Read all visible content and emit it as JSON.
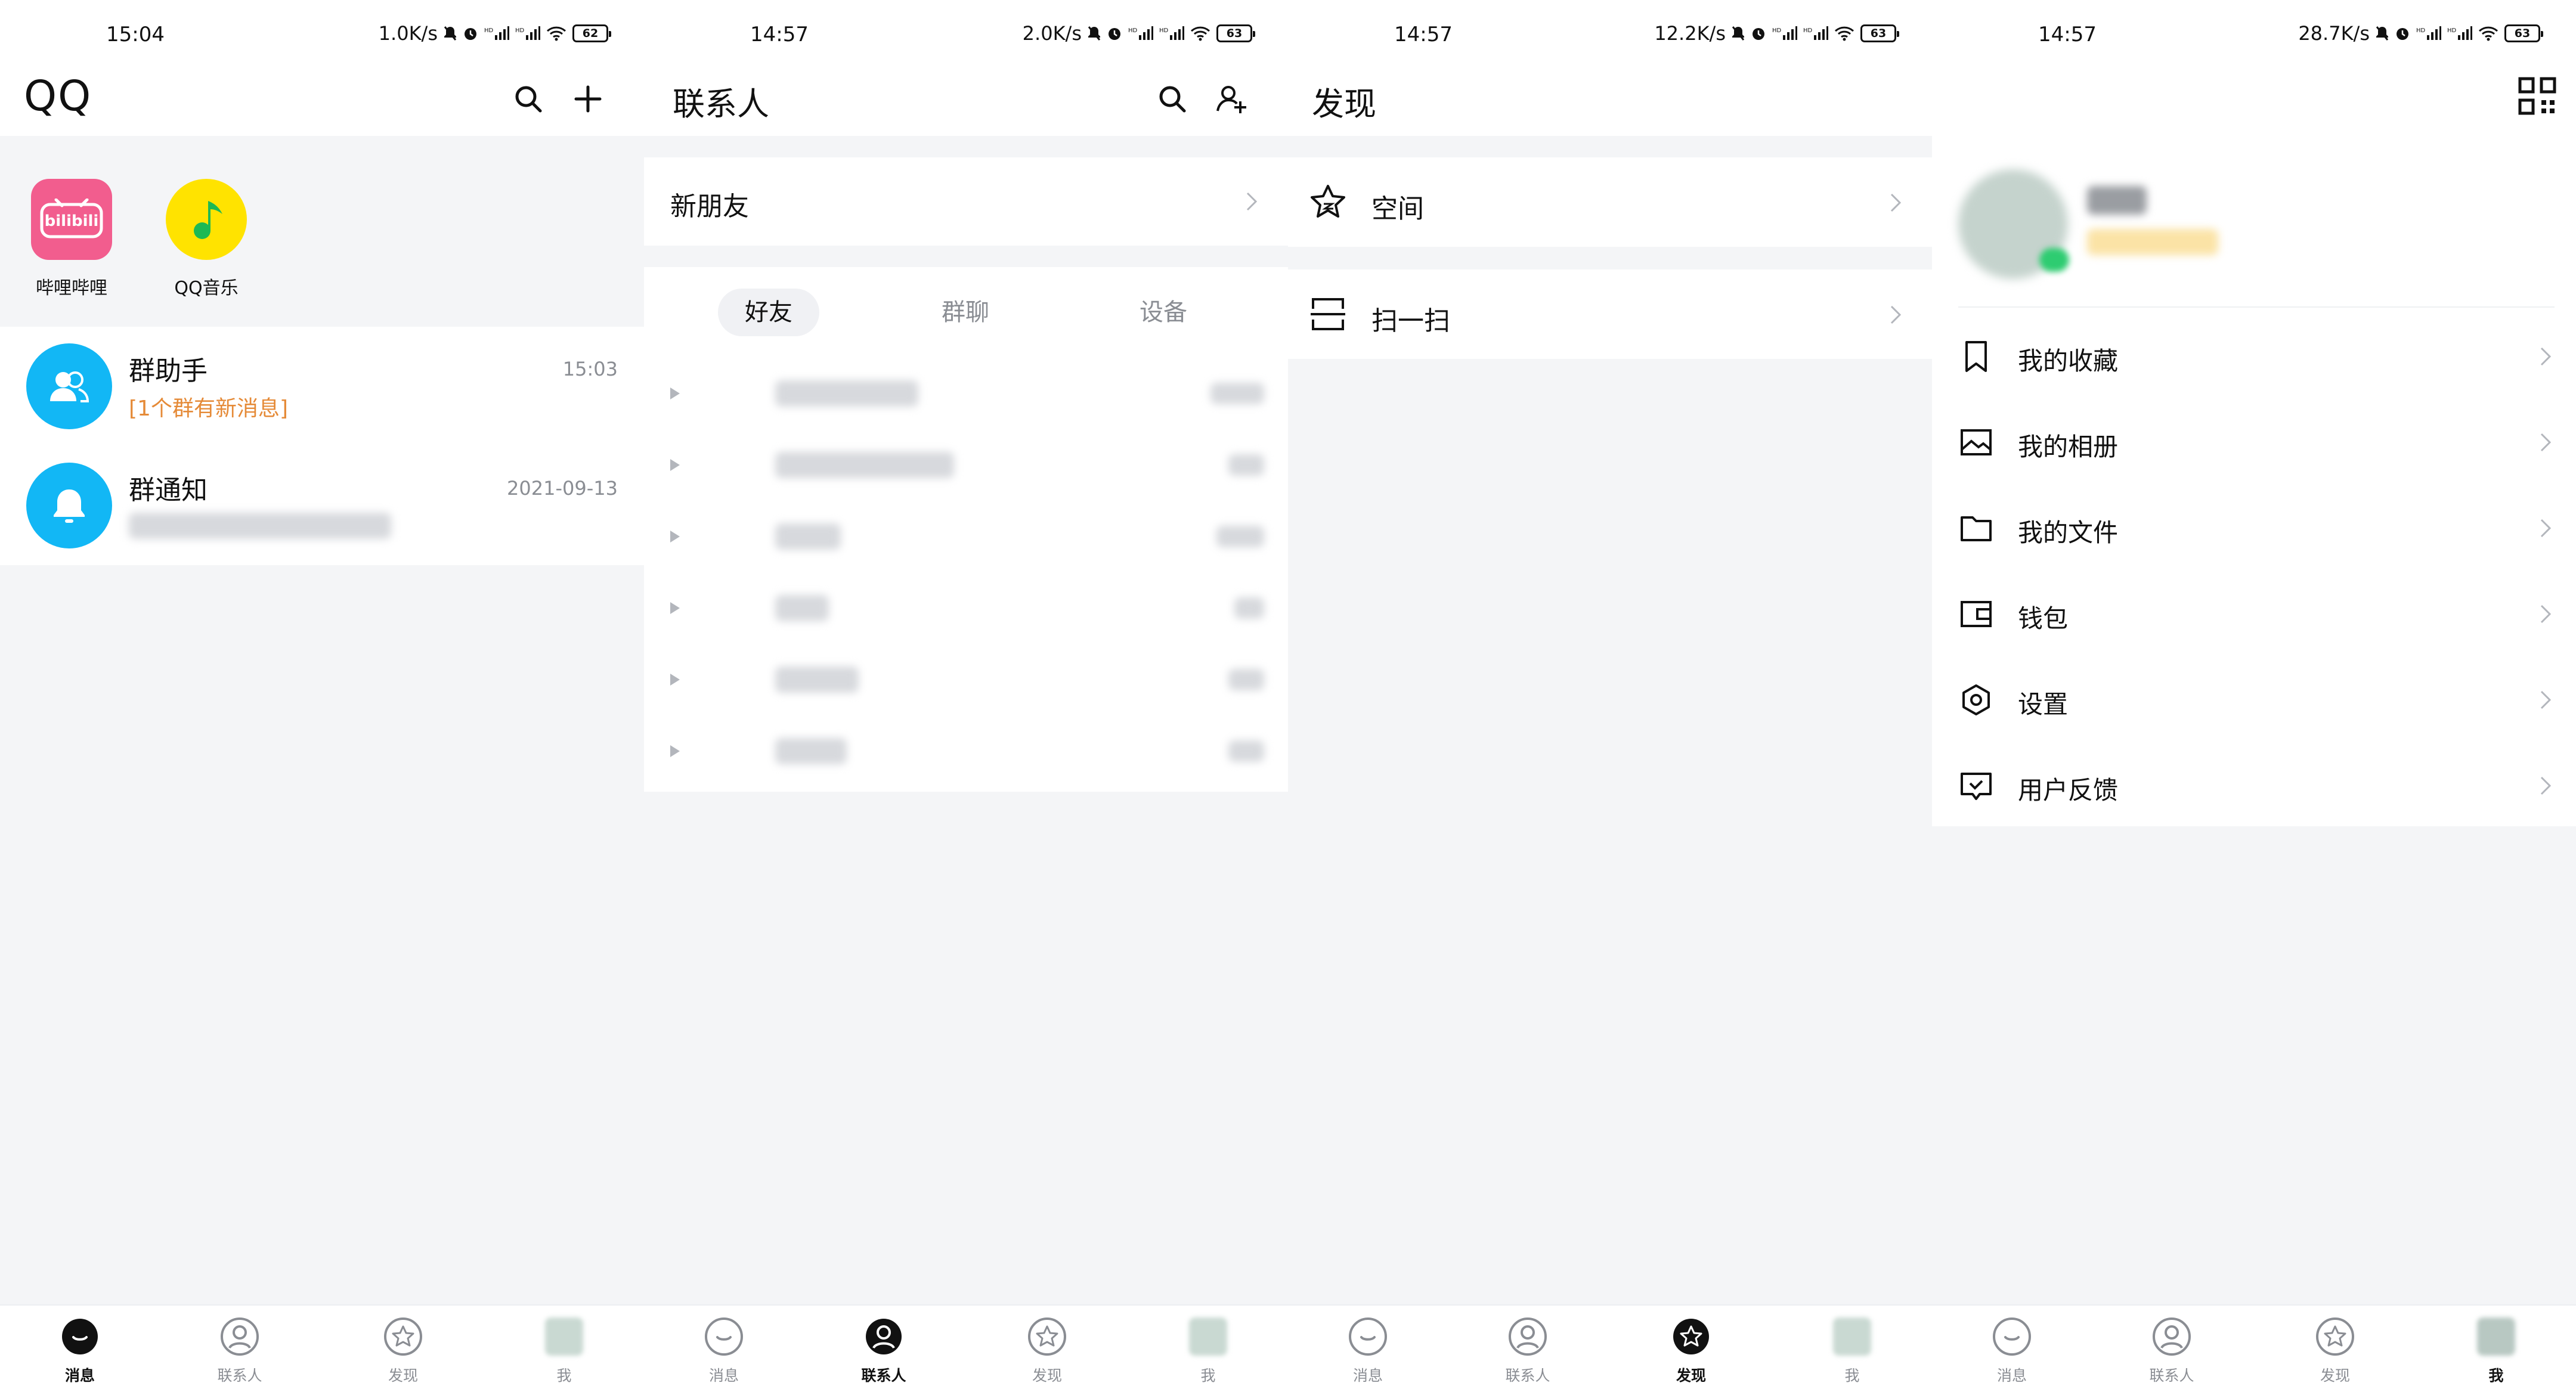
{
  "screens": [
    {
      "status": {
        "time": "15:04",
        "speed": "1.0K/s",
        "battery": "62"
      },
      "header": {
        "title": "QQ"
      },
      "apps": [
        {
          "label": "哔哩哔哩",
          "icon": "bilibili-icon",
          "color": "#f25d8e"
        },
        {
          "label": "QQ音乐",
          "icon": "qq-music-icon",
          "color": "#ffe300"
        }
      ],
      "conversations": [
        {
          "name": "群助手",
          "preview": "[1个群有新消息]",
          "time": "15:03",
          "icon": "group-assistant-icon"
        },
        {
          "name": "群通知",
          "preview": "",
          "time": "2021-09-13",
          "icon": "bell-icon"
        }
      ]
    },
    {
      "status": {
        "time": "14:57",
        "speed": "2.0K/s",
        "battery": "63"
      },
      "header": {
        "title": "联系人"
      },
      "new_friends": "新朋友",
      "tabs": [
        "好友",
        "群聊",
        "设备"
      ]
    },
    {
      "status": {
        "time": "14:57",
        "speed": "12.2K/s",
        "battery": "63"
      },
      "header": {
        "title": "发现"
      },
      "items": [
        {
          "label": "空间",
          "icon": "star-icon"
        },
        {
          "label": "扫一扫",
          "icon": "scan-icon"
        }
      ]
    },
    {
      "status": {
        "time": "14:57",
        "speed": "28.7K/s",
        "battery": "63"
      },
      "items": [
        {
          "label": "我的收藏",
          "icon": "bookmark-icon"
        },
        {
          "label": "我的相册",
          "icon": "album-icon"
        },
        {
          "label": "我的文件",
          "icon": "folder-icon"
        },
        {
          "label": "钱包",
          "icon": "wallet-icon"
        },
        {
          "label": "设置",
          "icon": "settings-icon"
        },
        {
          "label": "用户反馈",
          "icon": "feedback-icon"
        }
      ]
    }
  ],
  "nav": {
    "labels": [
      "消息",
      "联系人",
      "发现",
      "我"
    ],
    "icons": [
      "message-icon",
      "contacts-icon",
      "discover-icon",
      "profile-avatar-icon"
    ]
  },
  "colors": {
    "accent": "#12b7f5",
    "highlight": "#e58a37",
    "background": "#f4f5f7"
  }
}
